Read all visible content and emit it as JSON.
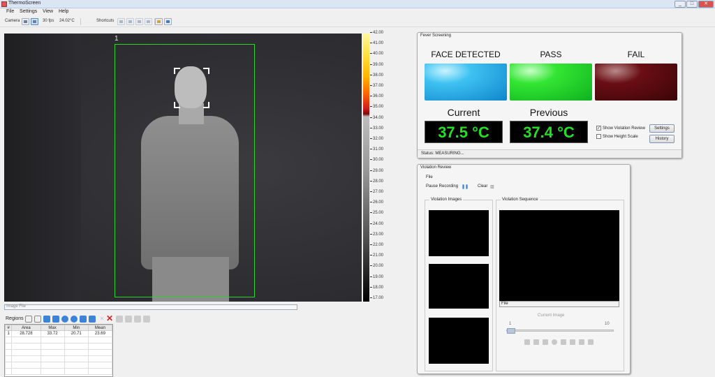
{
  "window": {
    "title": "ThermoScreen",
    "controls": [
      "_",
      "□",
      "✕"
    ]
  },
  "menu": [
    "File",
    "Settings",
    "View",
    "Help"
  ],
  "toolbar": {
    "camera_label": "Camera",
    "fps": "30 fps",
    "temp": "24.02°C",
    "shortcuts_label": "Shortcuts"
  },
  "thermal": {
    "region_id": "1"
  },
  "scale": {
    "ticks": [
      "42.00",
      "41.00",
      "40.00",
      "39.00",
      "38.00",
      "37.00",
      "36.00",
      "35.00",
      "34.00",
      "33.00",
      "32.00",
      "31.00",
      "30.00",
      "29.00",
      "28.00",
      "27.00",
      "26.00",
      "25.00",
      "24.00",
      "23.00",
      "22.00",
      "21.00",
      "20.00",
      "19.00",
      "18.00",
      "17.00"
    ]
  },
  "image_file": {
    "placeholder": "Image File"
  },
  "regions": {
    "label": "Regions",
    "columns": [
      "#",
      "Area",
      "Max",
      "Min",
      "Mean"
    ],
    "rows": [
      [
        "1",
        "28.728",
        "33.72",
        "20.71",
        "23.69"
      ]
    ]
  },
  "fever": {
    "title": "Fever Screening",
    "face_detected": "FACE DETECTED",
    "pass": "PASS",
    "fail": "FAIL",
    "current_label": "Current",
    "previous_label": "Previous",
    "current_value": "37.5 °C",
    "previous_value": "37.4 °C",
    "show_violation_review": "Show Violation Review",
    "show_height_scale": "Show Height Scale",
    "settings_button": "Settings",
    "history_button": "History",
    "status": "Status:  MEASURING..."
  },
  "violation": {
    "title": "Violation Review",
    "menu_file": "File",
    "pause_recording": "Pause Recording",
    "clear": "Clear",
    "images_group": "Violation Images",
    "sequence_group": "Violation Sequence",
    "file_label": "File",
    "current_image": "Current Image",
    "slider_min": "1",
    "slider_max": "10"
  },
  "colors": {
    "pass": "#22cc22",
    "fail": "#5a0a10",
    "face": "#1fa5e6",
    "temp_text": "#22e022",
    "roi_box": "#2ad62a"
  }
}
